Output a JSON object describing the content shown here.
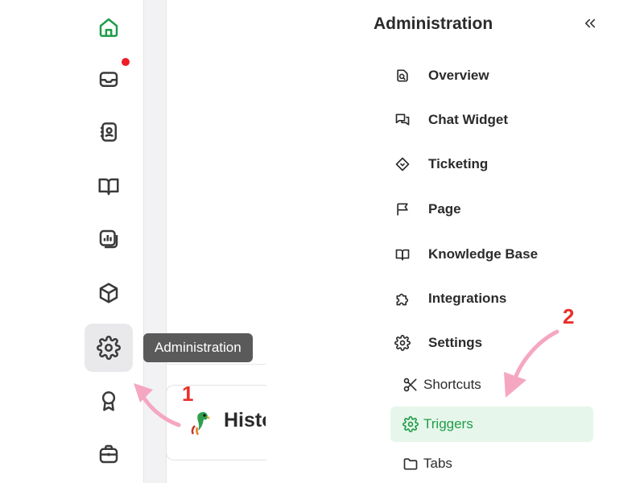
{
  "rail": {
    "items": [
      {
        "icon": "home-icon",
        "name": "rail-home"
      },
      {
        "icon": "inbox-icon",
        "name": "rail-inbox"
      },
      {
        "icon": "contacts-icon",
        "name": "rail-contacts"
      },
      {
        "icon": "book-icon",
        "name": "rail-knowledge"
      },
      {
        "icon": "reports-icon",
        "name": "rail-reports"
      },
      {
        "icon": "box-icon",
        "name": "rail-apps"
      },
      {
        "icon": "gear-icon",
        "name": "rail-administration"
      },
      {
        "icon": "award-icon",
        "name": "rail-achievements"
      },
      {
        "icon": "briefcase-icon",
        "name": "rail-tools"
      }
    ],
    "accent_color": "#1f9d4a",
    "notification_color": "#ee1c25"
  },
  "tooltip": {
    "text": "Administration"
  },
  "background_page": {
    "title": "Histo"
  },
  "panel": {
    "title": "Administration",
    "collapse_icon": "double-chevron-left-icon",
    "items": [
      {
        "label": "Overview",
        "icon": "overview-icon"
      },
      {
        "label": "Chat Widget",
        "icon": "chat-icon"
      },
      {
        "label": "Ticketing",
        "icon": "ticket-icon"
      },
      {
        "label": "Page",
        "icon": "flag-icon"
      },
      {
        "label": "Knowledge Base",
        "icon": "book-icon"
      },
      {
        "label": "Integrations",
        "icon": "puzzle-icon"
      },
      {
        "label": "Settings",
        "icon": "gear-icon"
      }
    ],
    "sub_items": [
      {
        "label": "Shortcuts",
        "icon": "scissors-icon",
        "active": false
      },
      {
        "label": "Triggers",
        "icon": "gear-icon",
        "active": true
      },
      {
        "label": "Tabs",
        "icon": "folder-icon",
        "active": false
      }
    ],
    "active_bg": "#e7f6ea",
    "active_color": "#1f9d4a"
  },
  "annotations": {
    "step1": "1",
    "step2": "2",
    "arrow_color": "#f5a7c2",
    "number_color": "#e8312a"
  }
}
